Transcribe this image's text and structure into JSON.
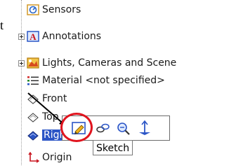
{
  "page": {
    "fragment_text": "t"
  },
  "tree": {
    "items": [
      {
        "label": "Sensors",
        "icon": "sensors-icon"
      },
      {
        "label": "Annotations",
        "icon": "annotations-icon"
      },
      {
        "label": "Lights, Cameras and Scene",
        "icon": "lights-cameras-icon"
      },
      {
        "label": "Material <not specified>",
        "icon": "material-icon"
      },
      {
        "label": "Front",
        "icon": "plane-icon"
      },
      {
        "label": "Top",
        "icon": "plane-icon"
      },
      {
        "label": "Right",
        "icon": "plane-icon",
        "selected": true
      },
      {
        "label": "Origin",
        "icon": "origin-icon"
      }
    ]
  },
  "context_toolbar": {
    "buttons": [
      "sketch-icon",
      "link-icon",
      "zoom-icon",
      "normal-to-icon"
    ]
  },
  "tooltip": {
    "text": "Sketch"
  },
  "colors": {
    "highlight": "#e0141e",
    "selection": "#2b55c6"
  }
}
